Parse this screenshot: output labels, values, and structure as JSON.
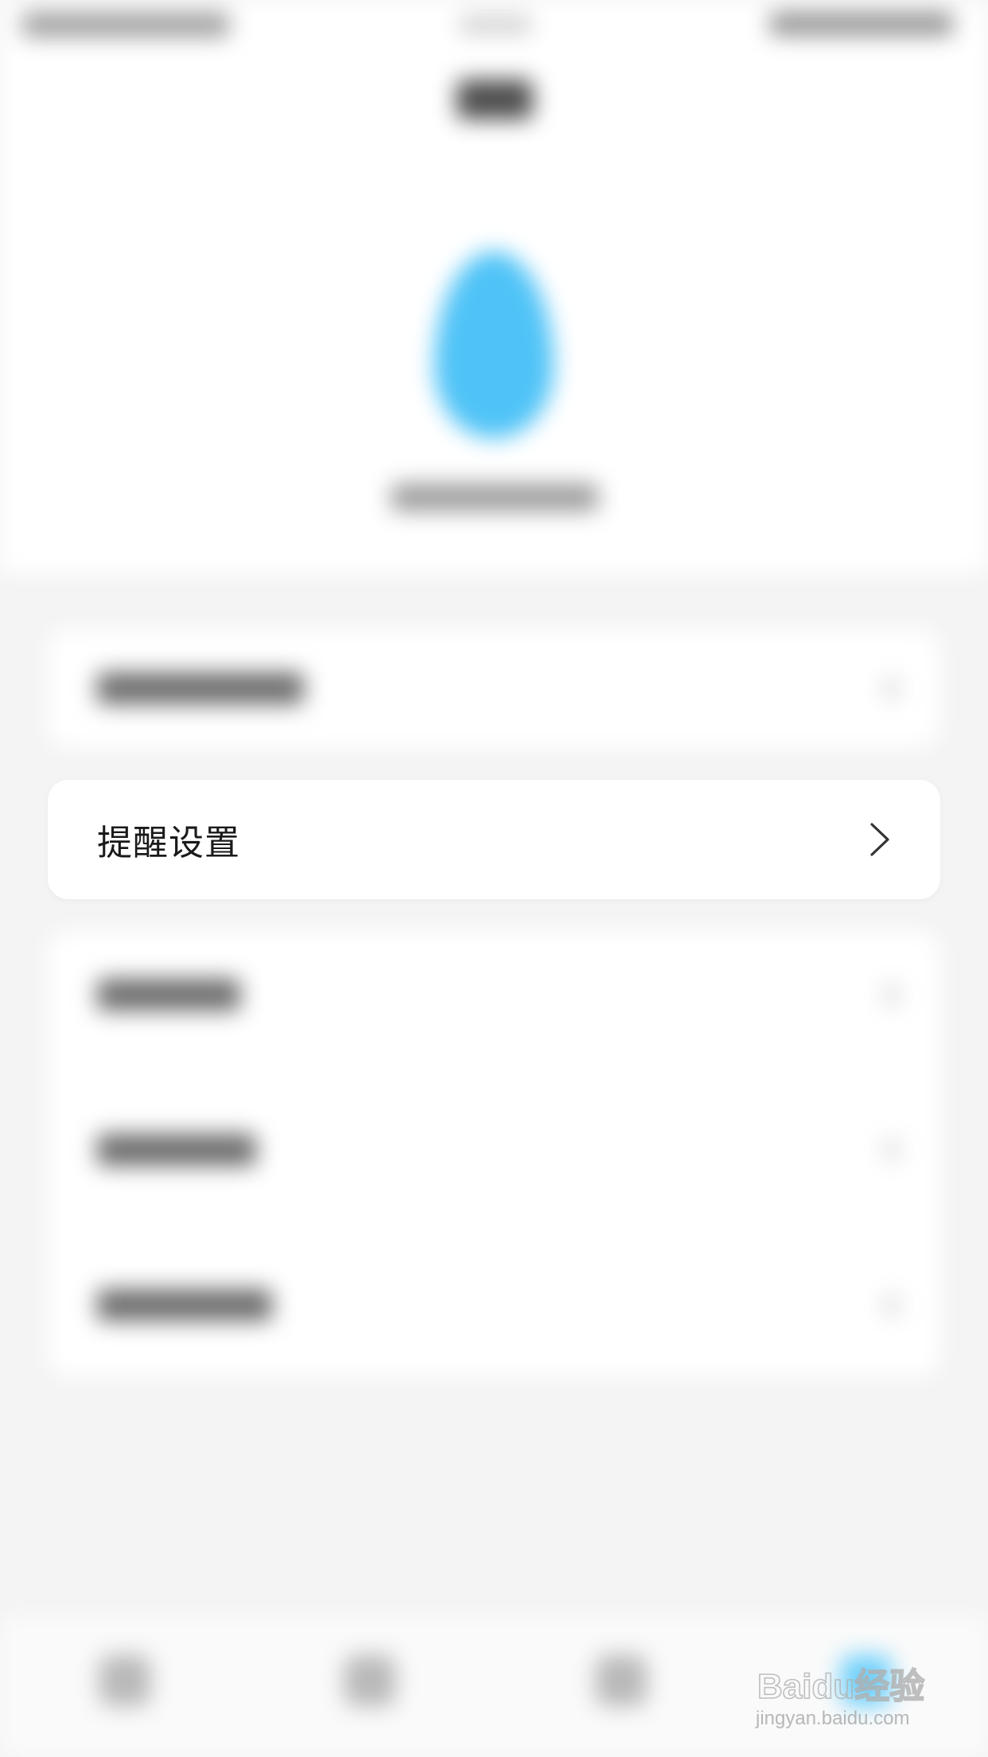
{
  "reminder_settings": {
    "label": "提醒设置",
    "chevron_icon": "chevron-right-icon"
  },
  "watermark": {
    "brand": "Baidu经验",
    "url": "jingyan.baidu.com"
  },
  "colors": {
    "accent": "#4fc3f7",
    "card_background": "#ffffff",
    "page_background": "#f4f4f4"
  },
  "icons": {
    "hero": "water-drop-icon",
    "nav_active": "water-drop-icon"
  }
}
